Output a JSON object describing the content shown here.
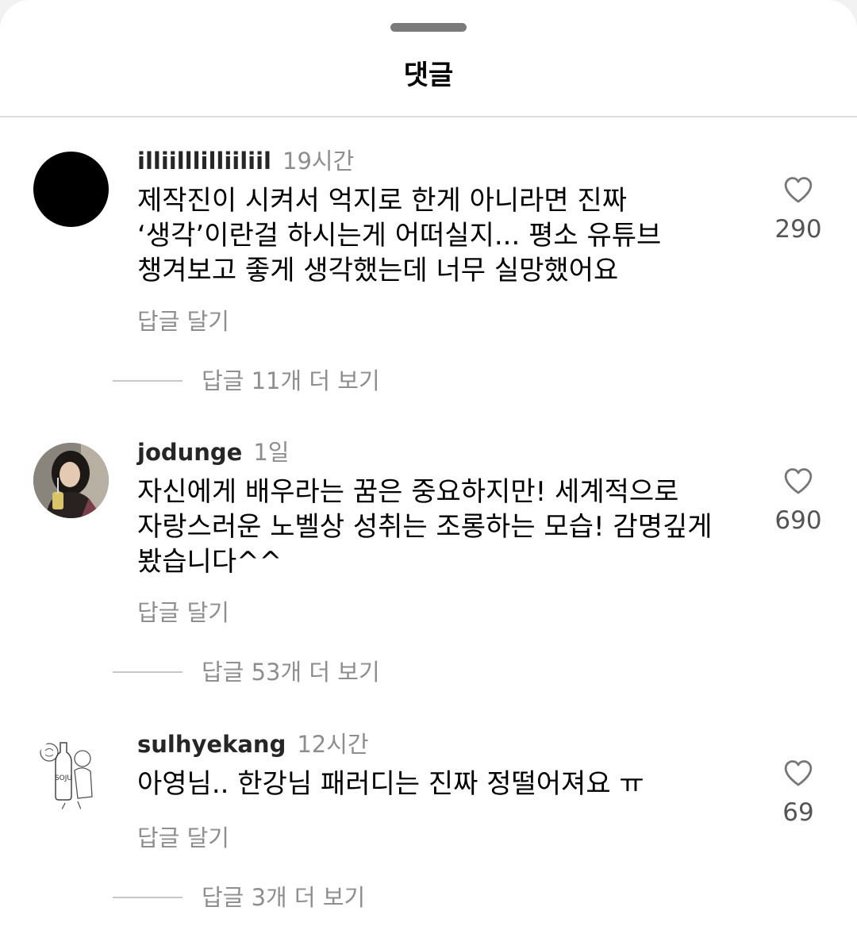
{
  "sheet": {
    "title": "댓글"
  },
  "comments": [
    {
      "username": "illiilllilliiliil",
      "time": "19시간",
      "text": "제작진이 시켜서 억지로 한게 아니라면 진짜\n‘생각’이란걸 하시는게 어떠실지... 평소 유튜브\n챙겨보고 좋게 생각했는데 너무 실망했어요",
      "reply_label": "답글 달기",
      "like_count": "290",
      "more_replies": "답글 11개 더 보기"
    },
    {
      "username": "jodunge",
      "time": "1일",
      "text": "자신에게 배우라는 꿈은 중요하지만! 세계적으로\n자랑스러운 노벨상 성취는 조롱하는 모습! 감명깊게\n봤습니다^^",
      "reply_label": "답글 달기",
      "like_count": "690",
      "more_replies": "답글 53개 더 보기"
    },
    {
      "username": "sulhyekang",
      "time": "12시간",
      "text": "아영님.. 한강님 패러디는 진짜 정떨어져요 ㅠ",
      "reply_label": "답글 달기",
      "like_count": "69",
      "more_replies": "답글 3개 더 보기",
      "avatar_text": "SOJU"
    }
  ]
}
